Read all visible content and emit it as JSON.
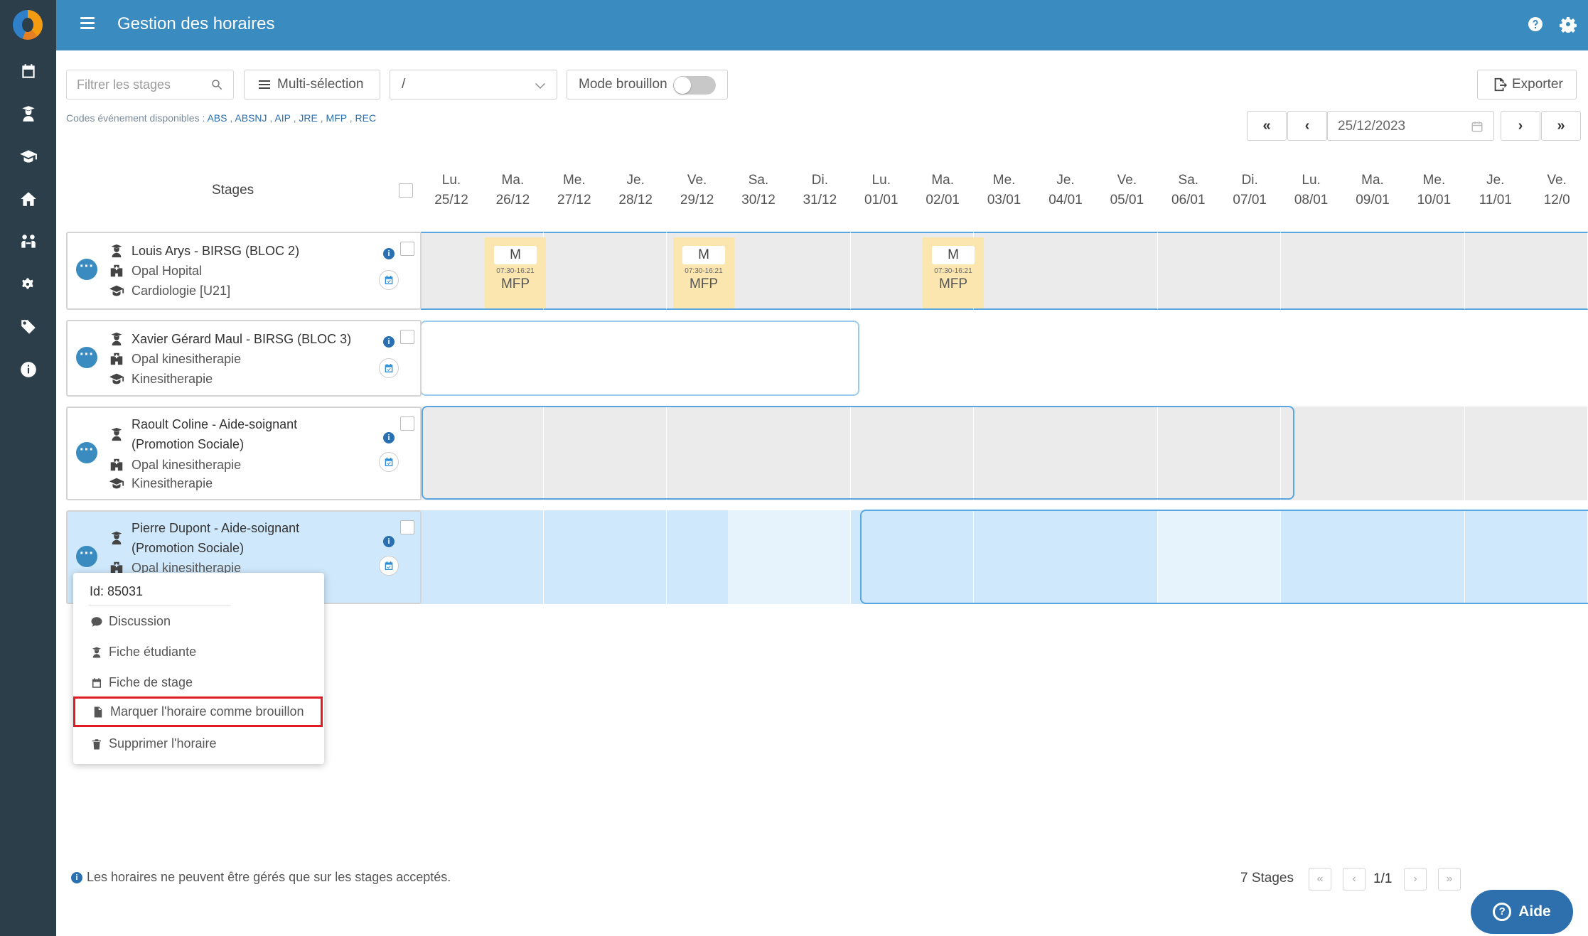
{
  "header": {
    "title": "Gestion des horaires"
  },
  "toolbar": {
    "filter_placeholder": "Filtrer les stages",
    "multi_label": "Multi-sélection",
    "select_value": "/",
    "draft_label": "Mode brouillon",
    "draft_on": false,
    "export_label": "Exporter"
  },
  "codes": {
    "prefix": "Codes événement disponibles :",
    "items": [
      "ABS",
      "ABSNJ",
      "AIP",
      "JRE",
      "MFP",
      "REC"
    ]
  },
  "datenav": {
    "first": "«",
    "prev": "‹",
    "date": "25/12/2023",
    "next": "›",
    "last": "»"
  },
  "grid": {
    "stages_header": "Stages",
    "days": [
      {
        "d": "Lu.",
        "n": "25/12"
      },
      {
        "d": "Ma.",
        "n": "26/12"
      },
      {
        "d": "Me.",
        "n": "27/12"
      },
      {
        "d": "Je.",
        "n": "28/12"
      },
      {
        "d": "Ve.",
        "n": "29/12"
      },
      {
        "d": "Sa.",
        "n": "30/12"
      },
      {
        "d": "Di.",
        "n": "31/12"
      },
      {
        "d": "Lu.",
        "n": "01/01"
      },
      {
        "d": "Ma.",
        "n": "02/01"
      },
      {
        "d": "Me.",
        "n": "03/01"
      },
      {
        "d": "Je.",
        "n": "04/01"
      },
      {
        "d": "Ve.",
        "n": "05/01"
      },
      {
        "d": "Sa.",
        "n": "06/01"
      },
      {
        "d": "Di.",
        "n": "07/01"
      },
      {
        "d": "Lu.",
        "n": "08/01"
      },
      {
        "d": "Ma.",
        "n": "09/01"
      },
      {
        "d": "Me.",
        "n": "10/01"
      },
      {
        "d": "Je.",
        "n": "11/01"
      },
      {
        "d": "Ve.",
        "n": "12/0"
      }
    ]
  },
  "stages": [
    {
      "name": "Louis Arys - BIRSG (BLOC 2)",
      "name2": "",
      "place": "Opal Hopital",
      "service": "Cardiologie [U21]"
    },
    {
      "name": "Xavier Gérard Maul - BIRSG (BLOC 3)",
      "name2": "",
      "place": "Opal kinesitherapie",
      "service": "Kinesitherapie"
    },
    {
      "name": "Raoult Coline - Aide-soignant",
      "name2": "(Promotion Sociale)",
      "place": "Opal kinesitherapie",
      "service": "Kinesitherapie"
    },
    {
      "name": "Pierre Dupont - Aide-soignant",
      "name2": "(Promotion Sociale)",
      "place": "Opal kinesitherapie",
      "service": ""
    }
  ],
  "events": [
    {
      "label": "M",
      "time": "07:30-16:21",
      "code": "MFP"
    },
    {
      "label": "M",
      "time": "07:30-16:21",
      "code": "MFP"
    },
    {
      "label": "M",
      "time": "07:30-16:21",
      "code": "MFP"
    }
  ],
  "context_menu": {
    "id_label": "Id: 85031",
    "items": [
      "Discussion",
      "Fiche étudiante",
      "Fiche de stage",
      "Marquer l'horaire comme brouillon",
      "Supprimer l'horaire"
    ]
  },
  "footer": {
    "note": "Les horaires ne peuvent être gérés que sur les stages acceptés.",
    "count": "7 Stages",
    "page": "1/1",
    "help": "Aide"
  },
  "colors": {
    "header": "#3a8bc0",
    "sidebar": "#2c3e4a",
    "event": "#fbe6b0",
    "selected": "#cfe8fb",
    "highlight": "#e01b24"
  }
}
